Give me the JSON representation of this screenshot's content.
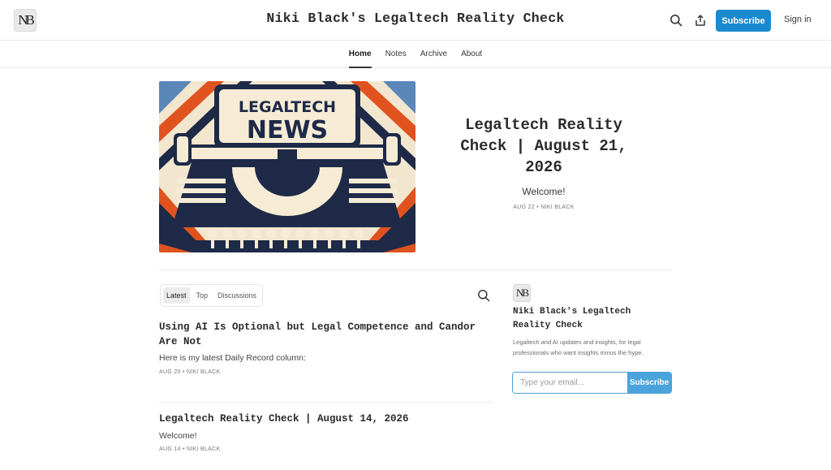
{
  "header": {
    "logo_text": "NB",
    "site_title": "Niki Black's Legaltech Reality Check",
    "subscribe_label": "Subscribe",
    "signin_label": "Sign in",
    "icons": [
      "search-icon",
      "share-icon"
    ],
    "accent_color": "#1a8ad0"
  },
  "nav": {
    "items": [
      {
        "label": "Home",
        "active": true
      },
      {
        "label": "Notes",
        "active": false
      },
      {
        "label": "Archive",
        "active": false
      },
      {
        "label": "About",
        "active": false
      }
    ]
  },
  "hero": {
    "image_text_line1": "LEGALTECH",
    "image_text_line2": "NEWS",
    "title": "Legaltech Reality Check | August 21, 2026",
    "subtitle": "Welcome!",
    "meta": "AUG 22 • NIKI BLACK"
  },
  "posts_tabs": {
    "items": [
      {
        "label": "Latest",
        "active": true
      },
      {
        "label": "Top",
        "active": false
      },
      {
        "label": "Discussions",
        "active": false
      }
    ]
  },
  "posts": [
    {
      "title": "Using AI Is Optional but Legal Competence and Candor Are Not",
      "subtitle": "Here is my latest Daily Record column:",
      "meta": "AUG 20 • NIKI BLACK"
    },
    {
      "title": "Legaltech Reality Check | August 14, 2026",
      "subtitle": "Welcome!",
      "meta": "AUG 14 • NIKI BLACK"
    }
  ],
  "sidebar": {
    "logo_text": "NB",
    "title": "Niki Black's Legaltech Reality Check",
    "description": "Legaltech and AI updates and insights, for legal professionals who want insights minus the hype.",
    "email_placeholder": "Type your email...",
    "subscribe_label": "Subscribe"
  }
}
